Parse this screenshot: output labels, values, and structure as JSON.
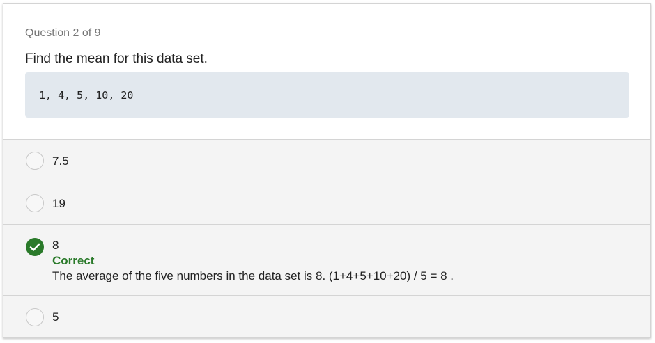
{
  "question": {
    "counter": "Question 2 of 9",
    "prompt": "Find the mean for this data set.",
    "dataset": "1, 4, 5, 10, 20"
  },
  "options": [
    {
      "label": "7.5",
      "state": "unselected"
    },
    {
      "label": "19",
      "state": "unselected"
    },
    {
      "label": "8",
      "state": "correct",
      "feedback_title": "Correct",
      "feedback_text": "The average of the five numbers in the data set is 8. (1+4+5+10+20) / 5 = 8 ."
    },
    {
      "label": "5",
      "state": "unselected"
    }
  ],
  "colors": {
    "correct": "#2a7a2a",
    "dataset_bg": "#e2e8ee",
    "option_bg": "#f4f4f4"
  },
  "icons": {
    "correct": "check-circle-icon",
    "unselected": "radio-circle-icon"
  }
}
